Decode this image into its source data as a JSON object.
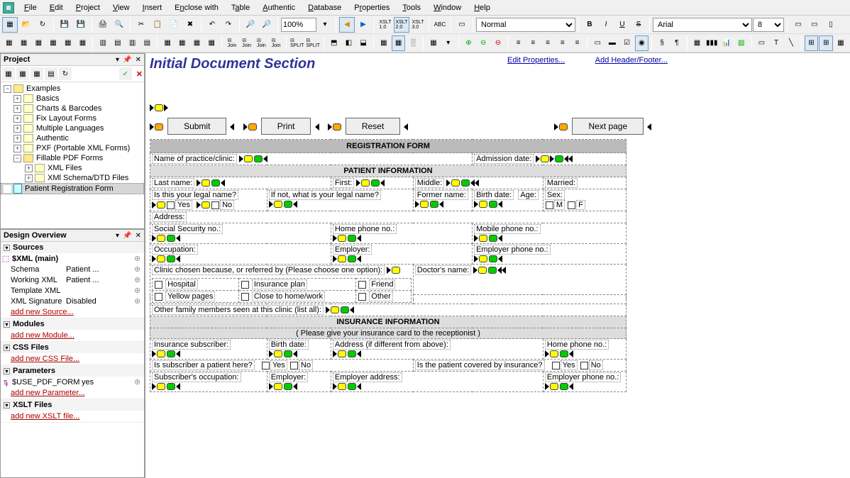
{
  "menu": [
    "File",
    "Edit",
    "Project",
    "View",
    "Insert",
    "Enclose with",
    "Table",
    "Authentic",
    "Database",
    "Properties",
    "Tools",
    "Window",
    "Help"
  ],
  "toolbar": {
    "zoom": "100%",
    "xslt": [
      "XSLT 1.0",
      "XSLT 2.0",
      "XSLT 3.0"
    ],
    "style_combo": "Normal",
    "font_combo": "Arial",
    "size_combo": "8"
  },
  "panels": {
    "project": {
      "title": "Project",
      "root": "Examples",
      "items": [
        "Basics",
        "Charts & Barcodes",
        "Fix Layout Forms",
        "Multiple Languages",
        "Authentic",
        "PXF (Portable XML Forms)",
        "Fillable PDF Forms"
      ],
      "sub": [
        "XML Files",
        "XMl Schema/DTD Files",
        "Patient Registration Form"
      ]
    },
    "design": {
      "title": "Design Overview",
      "sources": {
        "head": "Sources",
        "main": "$XML (main)",
        "rows": [
          {
            "k": "Schema",
            "v": "Patient ..."
          },
          {
            "k": "Working XML",
            "v": "Patient ..."
          },
          {
            "k": "Template XML",
            "v": ""
          },
          {
            "k": "XML Signature",
            "v": "Disabled"
          }
        ],
        "add": "add new Source..."
      },
      "sections": [
        {
          "head": "Modules",
          "add": "add new Module..."
        },
        {
          "head": "CSS Files",
          "add": "add new CSS File..."
        },
        {
          "head": "Parameters",
          "row": {
            "k": "$USE_PDF_FORM",
            "v": "yes"
          },
          "add": "add new Parameter..."
        },
        {
          "head": "XSLT Files",
          "add": "add new XSLT file..."
        }
      ]
    }
  },
  "doc": {
    "title": "Initial Document Section",
    "link1": "Edit Properties...",
    "link2": "Add Header/Footer...",
    "buttons": [
      "Submit",
      "Print",
      "Reset",
      "Next page"
    ],
    "form_title": "REGISTRATION FORM",
    "row1": {
      "a": "Name of practice/clinic:",
      "b": "Admission date:"
    },
    "section2": "PATIENT INFORMATION",
    "row2": {
      "a": "Last name:",
      "b": "First:",
      "c": "Middle:",
      "d": "Married:"
    },
    "row3": {
      "a": "Is this your legal name?",
      "b": "If not, what is your legal name?",
      "c": "Former name:",
      "d": "Birth date:",
      "e": "Age:",
      "f": "Sex:"
    },
    "row4": {
      "yes": "Yes",
      "no": "No",
      "m": "M",
      "f": "F"
    },
    "row5": "Address:",
    "row6": {
      "a": "Social Security no.:",
      "b": "Home phone no.:",
      "c": "Mobile phone no.:"
    },
    "row7": {
      "a": "Occupation:",
      "b": "Employer:",
      "c": "Employer phone no.:"
    },
    "row8": {
      "a": "Clinic chosen because, or referred by (Please choose one option):",
      "b": "Doctor's name:"
    },
    "row9": {
      "a": "Hospital",
      "b": "Insurance plan",
      "c": "Friend"
    },
    "row10": {
      "a": "Yellow pages",
      "b": "Close to home/work",
      "c": "Other"
    },
    "row11": "Other family members seen at this clinic (list all):",
    "section3": "INSURANCE INFORMATION",
    "section3b": "( Please give your insurance card to the receptionist )",
    "row12": {
      "a": "Insurance subscriber:",
      "b": "Birth date:",
      "c": "Address (if different from above):",
      "d": "Home phone no.:"
    },
    "row13": {
      "a": "Is subscriber a patient here?",
      "b": "Yes",
      "c": "No",
      "d": "Is the patient covered by insurance?",
      "e": "Yes",
      "f": "No"
    },
    "row14": {
      "a": "Subscriber's occupation:",
      "b": "Employer:",
      "c": "Employer address:",
      "d": "Employer phone no.:"
    }
  }
}
